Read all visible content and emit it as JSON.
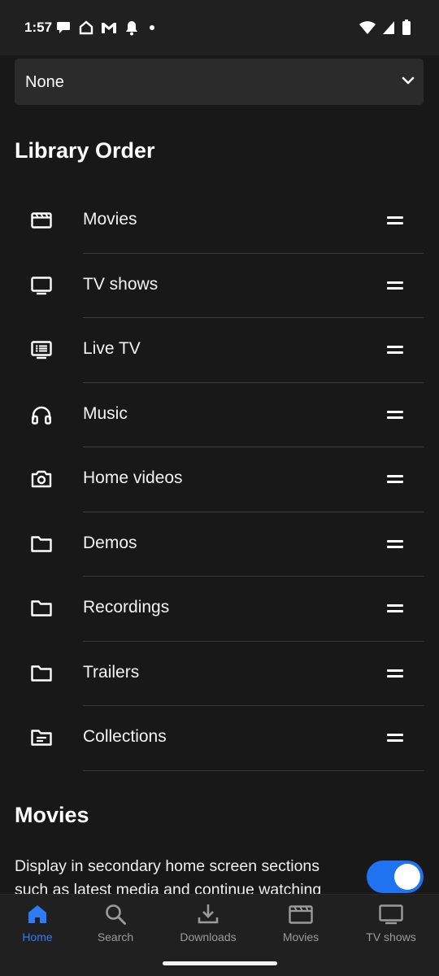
{
  "status_bar": {
    "time": "1:57",
    "notification_icons": [
      "chat-bubble-icon",
      "home-icon",
      "gmail-icon",
      "bell-icon",
      "dot-icon"
    ],
    "system_icons": [
      "wifi-icon",
      "signal-icon",
      "battery-icon"
    ]
  },
  "select": {
    "value": "None"
  },
  "library_order": {
    "title": "Library Order",
    "items": [
      {
        "label": "Movies",
        "icon": "clapperboard-icon"
      },
      {
        "label": "TV shows",
        "icon": "tv-icon"
      },
      {
        "label": "Live TV",
        "icon": "live-tv-icon"
      },
      {
        "label": "Music",
        "icon": "headphones-icon"
      },
      {
        "label": "Home videos",
        "icon": "camera-icon"
      },
      {
        "label": "Demos",
        "icon": "folder-icon"
      },
      {
        "label": "Recordings",
        "icon": "folder-icon"
      },
      {
        "label": "Trailers",
        "icon": "folder-icon"
      },
      {
        "label": "Collections",
        "icon": "collection-folder-icon"
      }
    ]
  },
  "movies_section": {
    "title": "Movies",
    "description": "Display in secondary home screen sections such as latest media and continue watching",
    "toggle_on": true
  },
  "bottom_nav": {
    "items": [
      {
        "label": "Home",
        "icon": "home-icon",
        "active": true
      },
      {
        "label": "Search",
        "icon": "search-icon",
        "active": false
      },
      {
        "label": "Downloads",
        "icon": "download-icon",
        "active": false
      },
      {
        "label": "Movies",
        "icon": "clapperboard-icon",
        "active": false
      },
      {
        "label": "TV shows",
        "icon": "tv-icon",
        "active": false
      }
    ]
  },
  "colors": {
    "background": "#181818",
    "bars": "#202020",
    "accent": "#1f73f0",
    "active_nav": "#2e7bf6"
  }
}
